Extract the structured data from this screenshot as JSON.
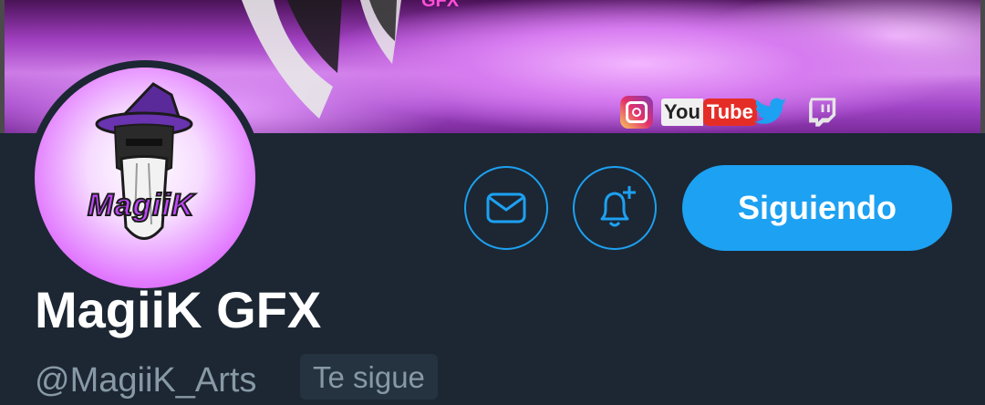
{
  "banner": {
    "partial_text": "GFX",
    "social_links": [
      {
        "icon": "instagram-icon"
      },
      {
        "icon": "youtube-logo",
        "text_you": "You",
        "text_tube": "Tube"
      },
      {
        "icon": "twitter-bird-icon"
      },
      {
        "icon": "twitch-icon"
      }
    ]
  },
  "avatar": {
    "logo_text": "MagiiK",
    "description": "wizard-mascot-logo"
  },
  "actions": {
    "message_icon": "envelope-icon",
    "notify_icon": "bell-plus-icon",
    "follow_label": "Siguiendo"
  },
  "profile": {
    "display_name": "MagiiK GFX",
    "handle": "@MagiiK_Arts",
    "follows_you_badge": "Te sigue"
  },
  "colors": {
    "background": "#1c2733",
    "accent": "#1da1f2",
    "secondary_text": "#8899a6",
    "badge_bg": "#253341"
  }
}
